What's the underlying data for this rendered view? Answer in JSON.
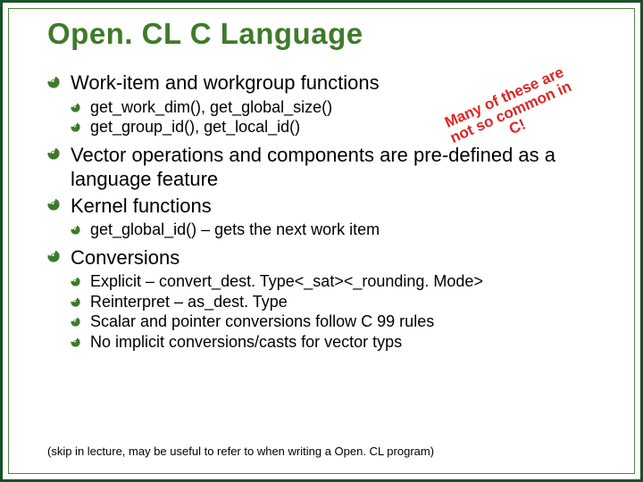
{
  "title": "Open. CL C Language",
  "callout": "Many of these are not so common in C!",
  "bullets": [
    {
      "label": "Work-item and workgroup functions",
      "sub": [
        "get_work_dim(), get_global_size()",
        "get_group_id(), get_local_id()"
      ]
    },
    {
      "label": "Vector operations and components are pre-defined as a language feature",
      "sub": []
    },
    {
      "label": "Kernel functions",
      "sub": [
        "get_global_id() – gets the next work item"
      ]
    },
    {
      "label": "Conversions",
      "sub": [
        "Explicit – convert_dest. Type<_sat><_rounding. Mode>",
        "Reinterpret – as_dest. Type",
        "Scalar and pointer conversions follow C 99 rules",
        "No implicit conversions/casts for vector typs"
      ]
    }
  ],
  "footer": "(skip in lecture, may be useful to refer to when writing a Open. CL program)"
}
